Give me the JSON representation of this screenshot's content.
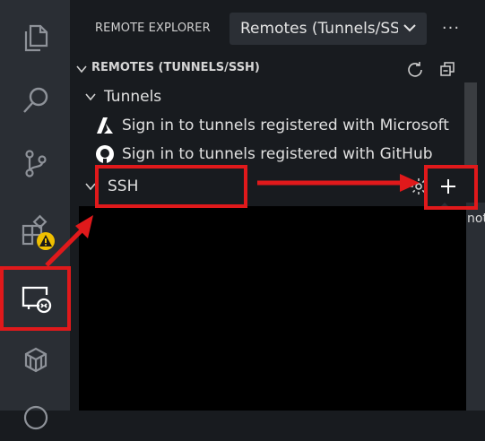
{
  "activity_bar": {
    "items": [
      {
        "icon": "files-icon"
      },
      {
        "icon": "search-icon"
      },
      {
        "icon": "source-control-icon"
      },
      {
        "icon": "extensions-icon",
        "badge": "warning"
      },
      {
        "icon": "remote-explorer-icon",
        "active": true
      },
      {
        "icon": "package-icon"
      }
    ]
  },
  "header": {
    "title": "REMOTE EXPLORER",
    "select_value": "Remotes (Tunnels/SSH)",
    "more_label": "···"
  },
  "section": {
    "title": "REMOTES (TUNNELS/SSH)"
  },
  "tree": {
    "tunnels_label": "Tunnels",
    "tunnels_items": [
      {
        "label": "Sign in to tunnels registered with Microsoft",
        "icon": "microsoft-icon"
      },
      {
        "label": "Sign in to tunnels registered with GitHub",
        "icon": "github-icon"
      }
    ],
    "ssh_label": "SSH"
  },
  "tooltip_fragment": "not",
  "colors": {
    "annotation": "#e0191b",
    "accent": "#ffffff",
    "warning": "#f0c000"
  }
}
